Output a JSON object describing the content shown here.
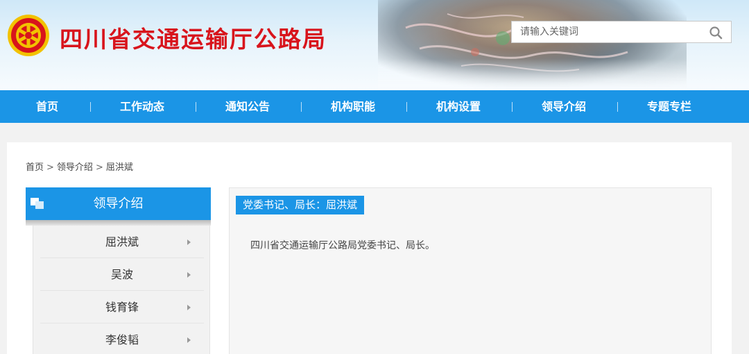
{
  "header": {
    "title": "四川省交通运输厅公路局",
    "logo_icon": "emblem-icon",
    "brand_red": "#d8141c",
    "search": {
      "placeholder": "请输入关键词",
      "value": "",
      "icon": "search-icon"
    }
  },
  "nav": {
    "color": "#1b95e6",
    "items": [
      {
        "label": "首页"
      },
      {
        "label": "工作动态"
      },
      {
        "label": "通知公告"
      },
      {
        "label": "机构职能"
      },
      {
        "label": "机构设置"
      },
      {
        "label": "领导介绍"
      },
      {
        "label": "专题专栏"
      }
    ]
  },
  "breadcrumb": {
    "items": [
      "首页",
      "领导介绍",
      "屈洪斌"
    ],
    "separator": ">"
  },
  "sidebar": {
    "title": "领导介绍",
    "icon": "document-stack-icon",
    "items": [
      {
        "label": "屈洪斌"
      },
      {
        "label": "吴波"
      },
      {
        "label": "钱育锋"
      },
      {
        "label": "李俊韬"
      }
    ]
  },
  "content": {
    "tag": "党委书记、局长：屈洪斌",
    "text": "四川省交通运输厅公路局党委书记、局长。"
  }
}
